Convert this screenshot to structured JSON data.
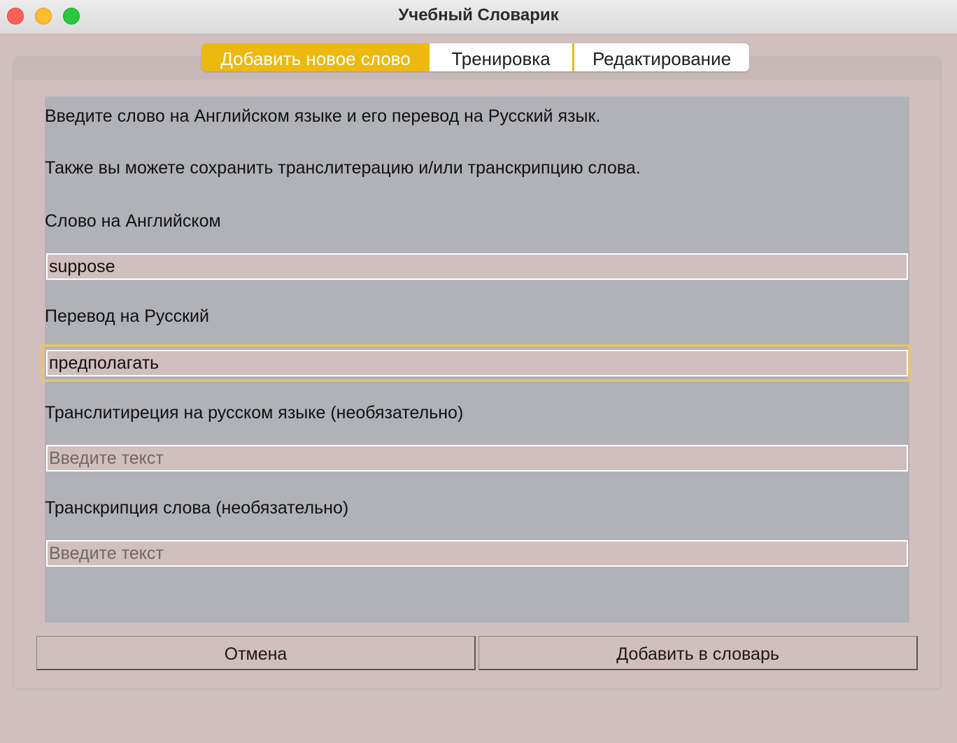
{
  "window": {
    "title": "Учебный Словарик"
  },
  "tabs": [
    {
      "label": "Добавить новое слово",
      "active": true
    },
    {
      "label": "Тренировка",
      "active": false
    },
    {
      "label": "Редактирование",
      "active": false
    }
  ],
  "form": {
    "intro_line1": "Введите слово на Английском языке и его перевод на Русский язык.",
    "intro_line2": "Также вы можете сохранить транслитерацию и/или транскрипцию слова.",
    "english_label": "Слово на Английском",
    "english_value": "suppose",
    "russian_label": "Перевод на Русский",
    "russian_value": "предполагать",
    "translit_label": "Транслитиреция на русском языке (необязательно)",
    "translit_placeholder": "Введите текст",
    "transcription_label": "Транскрипция слова (необязательно)",
    "transcription_placeholder": "Введите текст"
  },
  "buttons": {
    "cancel": "Отмена",
    "add": "Добавить в словарь"
  },
  "colors": {
    "active_tab": "#edb90f",
    "background": "#d0bfbe",
    "panel": "#b1b2b7"
  }
}
